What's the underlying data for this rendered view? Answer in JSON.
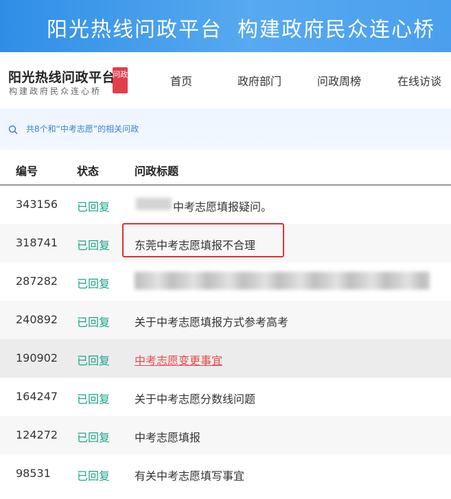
{
  "banner": {
    "title": "阳光热线问政平台",
    "slogan": "构建政府民众连心桥"
  },
  "logo": {
    "title": "阳光热线问政平台",
    "subtitle": "构建政府民众连心桥",
    "badge": "问政"
  },
  "nav": {
    "items": [
      "首页",
      "政府部门",
      "问政周榜",
      "在线访谈"
    ]
  },
  "search": {
    "icon": "search-icon",
    "result_text": "共8个和“中考志愿”的相关问政"
  },
  "table": {
    "columns": [
      "编号",
      "状态",
      "问政标题"
    ],
    "rows": [
      {
        "id": "343156",
        "status": "已回复",
        "title": "中考志愿填报疑问。"
      },
      {
        "id": "318741",
        "status": "已回复",
        "title": "东莞中考志愿填报不合理"
      },
      {
        "id": "287282",
        "status": "已回复",
        "title": ""
      },
      {
        "id": "240892",
        "status": "已回复",
        "title": "关于中考志愿填报方式参考高考"
      },
      {
        "id": "190902",
        "status": "已回复",
        "title": "中考志愿变更事宜"
      },
      {
        "id": "164247",
        "status": "已回复",
        "title": "关于中考志愿分数线问题"
      },
      {
        "id": "124272",
        "status": "已回复",
        "title": "中考志愿填报"
      },
      {
        "id": "98531",
        "status": "已回复",
        "title": "有关中考志愿填写事宜"
      }
    ]
  },
  "colors": {
    "banner_blue": "#3d97ea",
    "status_green": "#1aa38a",
    "link_red": "#e84a4a",
    "highlight_frame": "#e22d2d",
    "badge_red": "#e23f4b"
  }
}
